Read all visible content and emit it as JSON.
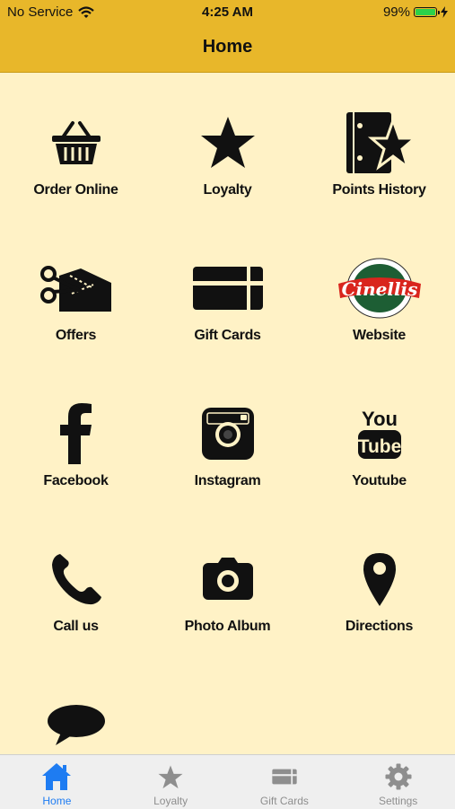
{
  "status_bar": {
    "carrier": "No Service",
    "time": "4:25 AM",
    "battery": "99%"
  },
  "nav": {
    "title": "Home"
  },
  "tiles": [
    {
      "label": "Order Online",
      "icon": "basket-icon"
    },
    {
      "label": "Loyalty",
      "icon": "star-icon"
    },
    {
      "label": "Points History",
      "icon": "book-star-icon"
    },
    {
      "label": "Offers",
      "icon": "scissors-coupon-icon"
    },
    {
      "label": "Gift Cards",
      "icon": "gift-card-icon"
    },
    {
      "label": "Website",
      "icon": "cinellis-logo"
    },
    {
      "label": "Facebook",
      "icon": "facebook-icon"
    },
    {
      "label": "Instagram",
      "icon": "instagram-icon"
    },
    {
      "label": "Youtube",
      "icon": "youtube-icon"
    },
    {
      "label": "Call us",
      "icon": "phone-icon"
    },
    {
      "label": "Photo Album",
      "icon": "camera-icon"
    },
    {
      "label": "Directions",
      "icon": "map-pin-icon"
    },
    {
      "label": "",
      "icon": "chat-bubble-icon"
    }
  ],
  "logo_text": "Cinellis",
  "tabbar": [
    {
      "label": "Home",
      "icon": "home-icon",
      "active": true
    },
    {
      "label": "Loyalty",
      "icon": "star-icon",
      "active": false
    },
    {
      "label": "Gift Cards",
      "icon": "gift-card-icon",
      "active": false
    },
    {
      "label": "Settings",
      "icon": "gear-icon",
      "active": false
    }
  ],
  "colors": {
    "header": "#e8b72a",
    "background": "#fff2c6",
    "active_tab": "#1e7cf2",
    "inactive_tab": "#8e8e8e"
  }
}
